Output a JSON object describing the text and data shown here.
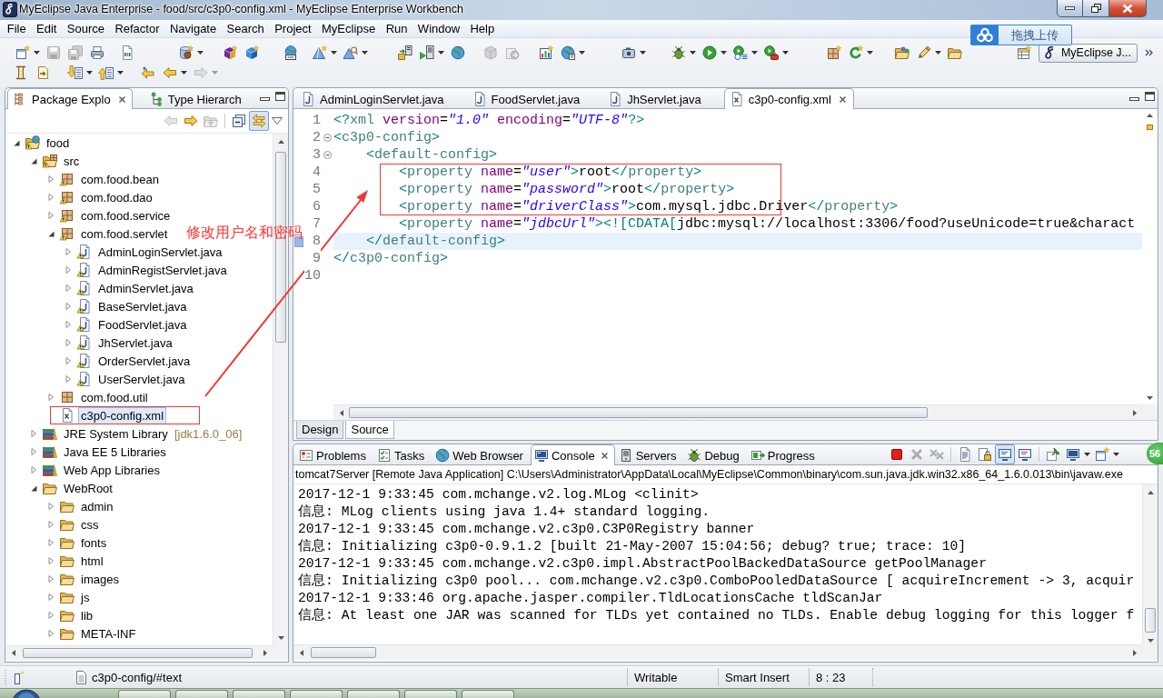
{
  "window": {
    "title": "MyEclipse Java Enterprise - food/src/c3p0-config.xml - MyEclipse Enterprise Workbench"
  },
  "menu_bar": [
    "File",
    "Edit",
    "Source",
    "Refactor",
    "Navigate",
    "Search",
    "Project",
    "MyEclipse",
    "Run",
    "Window",
    "Help"
  ],
  "toolbar": {
    "rows": [
      [
        [
          {
            "kind": "new-wizard",
            "dropdown": true,
            "disabled": false
          },
          {
            "kind": "save",
            "dropdown": false,
            "disabled": true
          },
          {
            "kind": "save-all",
            "dropdown": false,
            "disabled": true
          },
          {
            "kind": "print",
            "dropdown": false,
            "disabled": false
          }
        ],
        [
          {
            "kind": "binary",
            "dropdown": false,
            "disabled": false
          }
        ],
        [
          {
            "kind": "database-bean",
            "dropdown": true,
            "disabled": false
          }
        ],
        [
          {
            "kind": "cube-purple",
            "dropdown": false,
            "disabled": false
          },
          {
            "kind": "cube-blue",
            "dropdown": false,
            "disabled": false
          }
        ],
        [
          {
            "kind": "web-service",
            "dropdown": false,
            "disabled": false
          }
        ],
        [
          {
            "kind": "pyramid-new",
            "dropdown": true,
            "disabled": false
          },
          {
            "kind": "pyramid-search",
            "dropdown": true,
            "disabled": false
          }
        ],
        [
          {
            "kind": "server-deploy",
            "dropdown": false,
            "disabled": false
          },
          {
            "kind": "run-server",
            "dropdown": true,
            "disabled": false
          },
          {
            "kind": "globe",
            "dropdown": false,
            "disabled": false
          }
        ],
        [
          {
            "kind": "box-export",
            "dropdown": false,
            "disabled": true
          },
          {
            "kind": "disc-export",
            "dropdown": false,
            "disabled": true
          }
        ],
        [
          {
            "kind": "chart",
            "dropdown": false,
            "disabled": false
          },
          {
            "kind": "globe-run",
            "dropdown": true,
            "disabled": false
          }
        ],
        [
          {
            "kind": "camera",
            "dropdown": true,
            "disabled": false
          }
        ],
        [
          {
            "kind": "bug",
            "dropdown": true,
            "disabled": false
          },
          {
            "kind": "run",
            "dropdown": true,
            "disabled": false
          },
          {
            "kind": "run-history",
            "dropdown": true,
            "disabled": false
          },
          {
            "kind": "external-tools",
            "dropdown": true,
            "disabled": false
          }
        ],
        [
          {
            "kind": "new-package",
            "dropdown": false,
            "disabled": false
          },
          {
            "kind": "refresh",
            "dropdown": true,
            "disabled": false
          }
        ],
        [
          {
            "kind": "open-project",
            "dropdown": false,
            "disabled": false
          },
          {
            "kind": "pencil",
            "dropdown": true,
            "disabled": false
          },
          {
            "kind": "folder-open",
            "dropdown": false,
            "disabled": false
          }
        ]
      ],
      [
        [
          {
            "kind": "annotation-a",
            "dropdown": false,
            "disabled": false
          },
          {
            "kind": "annotation-b",
            "dropdown": false,
            "disabled": false
          }
        ],
        [
          {
            "kind": "next-annotation",
            "dropdown": true,
            "disabled": false
          },
          {
            "kind": "prev-annotation",
            "dropdown": true,
            "disabled": false
          }
        ],
        [
          {
            "kind": "last-edit",
            "dropdown": false,
            "disabled": false
          },
          {
            "kind": "back",
            "dropdown": true,
            "disabled": false
          },
          {
            "kind": "forward",
            "dropdown": true,
            "disabled": true
          }
        ]
      ]
    ],
    "perspective": {
      "label": "MyEclipse J..."
    }
  },
  "upload_widget": {
    "label": "拖拽上传"
  },
  "package_explorer": {
    "tabs": [
      {
        "label": "Package Explo",
        "kind": "package-explorer",
        "selected": true
      },
      {
        "label": "Type Hierarch",
        "kind": "type-hierarchy",
        "selected": false
      }
    ],
    "toolbar": [
      [
        {
          "kind": "back",
          "disabled": true,
          "pressed": false
        },
        {
          "kind": "forward",
          "disabled": false,
          "pressed": false
        },
        {
          "kind": "up",
          "disabled": true,
          "pressed": false
        }
      ],
      [
        {
          "kind": "collapse-all",
          "disabled": false,
          "pressed": false
        },
        {
          "kind": "link-editor",
          "disabled": false,
          "pressed": true
        },
        {
          "kind": "view-menu",
          "disabled": false,
          "pressed": false
        }
      ]
    ],
    "tree": [
      {
        "label": "food",
        "kind": "project",
        "expanded": true,
        "selected": false,
        "warning": true,
        "children": [
          {
            "label": "src",
            "kind": "source-folder",
            "expanded": true,
            "selected": false,
            "warning": true,
            "children": [
              {
                "label": "com.food.bean",
                "kind": "package",
                "expanded": false,
                "selected": false,
                "warning": true
              },
              {
                "label": "com.food.dao",
                "kind": "package",
                "expanded": false,
                "selected": false,
                "warning": true
              },
              {
                "label": "com.food.service",
                "kind": "package",
                "expanded": false,
                "selected": false,
                "warning": true
              },
              {
                "label": "com.food.servlet",
                "kind": "package",
                "expanded": true,
                "selected": false,
                "warning": true,
                "children": [
                  {
                    "label": "AdminLoginServlet.java",
                    "kind": "java-file",
                    "expanded": false,
                    "selected": false,
                    "warning": true
                  },
                  {
                    "label": "AdminRegistServlet.java",
                    "kind": "java-file",
                    "expanded": false,
                    "selected": false,
                    "warning": true
                  },
                  {
                    "label": "AdminServlet.java",
                    "kind": "java-file",
                    "expanded": false,
                    "selected": false,
                    "warning": true
                  },
                  {
                    "label": "BaseServlet.java",
                    "kind": "java-file",
                    "expanded": false,
                    "selected": false,
                    "warning": true
                  },
                  {
                    "label": "FoodServlet.java",
                    "kind": "java-file",
                    "expanded": false,
                    "selected": false,
                    "warning": true
                  },
                  {
                    "label": "JhServlet.java",
                    "kind": "java-file",
                    "expanded": false,
                    "selected": false,
                    "warning": true
                  },
                  {
                    "label": "OrderServlet.java",
                    "kind": "java-file",
                    "expanded": false,
                    "selected": false,
                    "warning": true
                  },
                  {
                    "label": "UserServlet.java",
                    "kind": "java-file",
                    "expanded": false,
                    "selected": false,
                    "warning": true
                  }
                ]
              },
              {
                "label": "com.food.util",
                "kind": "package",
                "expanded": false,
                "selected": false,
                "warning": false
              },
              {
                "label": "c3p0-config.xml",
                "kind": "xml-file",
                "selected": true,
                "warning": false
              }
            ]
          },
          {
            "label": "JRE System Library",
            "decoration": "[jdk1.6.0_06]",
            "kind": "library",
            "expanded": false,
            "selected": false,
            "warning": false
          },
          {
            "label": "Java EE 5 Libraries",
            "kind": "library",
            "expanded": false,
            "selected": false,
            "warning": false
          },
          {
            "label": "Web App Libraries",
            "kind": "library",
            "expanded": false,
            "selected": false,
            "warning": false
          },
          {
            "label": "WebRoot",
            "kind": "folder",
            "expanded": true,
            "selected": false,
            "warning": false,
            "children": [
              {
                "label": "admin",
                "kind": "folder",
                "expanded": false,
                "selected": false,
                "warning": false
              },
              {
                "label": "css",
                "kind": "folder",
                "expanded": false,
                "selected": false,
                "warning": false
              },
              {
                "label": "fonts",
                "kind": "folder",
                "expanded": false,
                "selected": false,
                "warning": false
              },
              {
                "label": "html",
                "kind": "folder",
                "expanded": false,
                "selected": false,
                "warning": false
              },
              {
                "label": "images",
                "kind": "folder",
                "expanded": false,
                "selected": false,
                "warning": false
              },
              {
                "label": "js",
                "kind": "folder",
                "expanded": false,
                "selected": false,
                "warning": false
              },
              {
                "label": "lib",
                "kind": "folder",
                "expanded": false,
                "selected": false,
                "warning": false
              },
              {
                "label": "META-INF",
                "kind": "folder",
                "expanded": false,
                "selected": false,
                "warning": false
              }
            ]
          }
        ]
      }
    ]
  },
  "editor": {
    "tabs": [
      {
        "label": "AdminLoginServlet.java",
        "kind": "java",
        "selected": false
      },
      {
        "label": "FoodServlet.java",
        "kind": "java",
        "selected": false
      },
      {
        "label": "JhServlet.java",
        "kind": "java",
        "selected": false
      },
      {
        "label": "c3p0-config.xml",
        "kind": "xml",
        "selected": true
      }
    ],
    "lines": [
      {
        "number": "1",
        "current": false,
        "marker": false,
        "tokens": [
          {
            "kind": "delimiter",
            "text": "<?"
          },
          {
            "kind": "tag",
            "text": "xml"
          },
          {
            "kind": "attr",
            "text": " version"
          },
          {
            "kind": "plain",
            "text": "="
          },
          {
            "kind": "value",
            "text": "\"1.0\""
          },
          {
            "kind": "attr",
            "text": " encoding"
          },
          {
            "kind": "plain",
            "text": "="
          },
          {
            "kind": "value",
            "text": "\"UTF-8\""
          },
          {
            "kind": "delimiter",
            "text": "?>"
          }
        ]
      },
      {
        "number": "2",
        "current": false,
        "marker": false,
        "expanded": true,
        "tokens": [
          {
            "kind": "delimiter",
            "text": "<"
          },
          {
            "kind": "tag",
            "text": "c3p0-config"
          },
          {
            "kind": "delimiter",
            "text": ">"
          }
        ]
      },
      {
        "number": "3",
        "current": false,
        "marker": false,
        "expanded": true,
        "tokens": [
          {
            "kind": "delimiter",
            "text": "    <"
          },
          {
            "kind": "tag",
            "text": "default-config"
          },
          {
            "kind": "delimiter",
            "text": ">"
          }
        ]
      },
      {
        "number": "4",
        "current": false,
        "marker": false,
        "tokens": [
          {
            "kind": "delimiter",
            "text": "        <"
          },
          {
            "kind": "tag",
            "text": "property"
          },
          {
            "kind": "attr",
            "text": " name"
          },
          {
            "kind": "plain",
            "text": "="
          },
          {
            "kind": "value",
            "text": "\"user\""
          },
          {
            "kind": "delimiter",
            "text": ">"
          },
          {
            "kind": "plain",
            "text": "root"
          },
          {
            "kind": "delimiter",
            "text": "</"
          },
          {
            "kind": "tag",
            "text": "property"
          },
          {
            "kind": "delimiter",
            "text": ">"
          }
        ]
      },
      {
        "number": "5",
        "current": false,
        "marker": false,
        "tokens": [
          {
            "kind": "delimiter",
            "text": "        <"
          },
          {
            "kind": "tag",
            "text": "property"
          },
          {
            "kind": "attr",
            "text": " name"
          },
          {
            "kind": "plain",
            "text": "="
          },
          {
            "kind": "value",
            "text": "\"password\""
          },
          {
            "kind": "delimiter",
            "text": ">"
          },
          {
            "kind": "plain",
            "text": "root"
          },
          {
            "kind": "delimiter",
            "text": "</"
          },
          {
            "kind": "tag",
            "text": "property"
          },
          {
            "kind": "delimiter",
            "text": ">"
          }
        ]
      },
      {
        "number": "6",
        "current": false,
        "marker": false,
        "tokens": [
          {
            "kind": "delimiter",
            "text": "        <"
          },
          {
            "kind": "tag",
            "text": "property"
          },
          {
            "kind": "attr",
            "text": " name"
          },
          {
            "kind": "plain",
            "text": "="
          },
          {
            "kind": "value",
            "text": "\"driverClass\""
          },
          {
            "kind": "delimiter",
            "text": ">"
          },
          {
            "kind": "plain",
            "text": "com.mysql.jdbc.Driver"
          },
          {
            "kind": "delimiter",
            "text": "</"
          },
          {
            "kind": "tag",
            "text": "property"
          },
          {
            "kind": "delimiter",
            "text": ">"
          }
        ]
      },
      {
        "number": "7",
        "current": false,
        "marker": false,
        "tokens": [
          {
            "kind": "delimiter",
            "text": "        <"
          },
          {
            "kind": "tag",
            "text": "property"
          },
          {
            "kind": "attr",
            "text": " name"
          },
          {
            "kind": "plain",
            "text": "="
          },
          {
            "kind": "value",
            "text": "\"jdbcUrl\""
          },
          {
            "kind": "delimiter",
            "text": "><![CDATA["
          },
          {
            "kind": "plain",
            "text": "jdbc:mysql://localhost:3306/food?useUnicode=true&charact"
          }
        ]
      },
      {
        "number": "8",
        "current": true,
        "marker": true,
        "tokens": [
          {
            "kind": "delimiter",
            "text": "    </"
          },
          {
            "kind": "tag",
            "text": "default-config"
          },
          {
            "kind": "delimiter",
            "text": ">"
          }
        ]
      },
      {
        "number": "9",
        "current": false,
        "marker": false,
        "tokens": [
          {
            "kind": "delimiter",
            "text": "</"
          },
          {
            "kind": "tag",
            "text": "c3p0-config"
          },
          {
            "kind": "delimiter",
            "text": ">"
          }
        ]
      },
      {
        "number": "10",
        "current": false,
        "marker": false
      }
    ],
    "mode_tabs": [
      {
        "label": "Design",
        "selected": false
      },
      {
        "label": "Source",
        "selected": true
      }
    ]
  },
  "console_view": {
    "tabs": [
      {
        "label": "Problems",
        "kind": "problems",
        "selected": false
      },
      {
        "label": "Tasks",
        "kind": "tasks",
        "selected": false
      },
      {
        "label": "Web Browser",
        "kind": "web-browser",
        "selected": false
      },
      {
        "label": "Console",
        "kind": "console",
        "selected": true
      },
      {
        "label": "Servers",
        "kind": "servers",
        "selected": false
      },
      {
        "label": "Debug",
        "kind": "debug",
        "selected": false
      },
      {
        "label": "Progress",
        "kind": "progress",
        "selected": false
      }
    ],
    "toolbar": [
      [
        {
          "kind": "terminate",
          "disabled": false,
          "pressed": false,
          "dropdown": false
        },
        {
          "kind": "remove-launch",
          "disabled": true,
          "pressed": false,
          "dropdown": false
        },
        {
          "kind": "remove-all",
          "disabled": true,
          "pressed": false,
          "dropdown": false
        }
      ],
      [
        {
          "kind": "clear-console",
          "disabled": false,
          "pressed": false,
          "dropdown": false
        },
        {
          "kind": "scroll-lock",
          "disabled": false,
          "pressed": false,
          "dropdown": false
        },
        {
          "kind": "show-on-output",
          "disabled": false,
          "pressed": true,
          "dropdown": false
        },
        {
          "kind": "show-on-error",
          "disabled": false,
          "pressed": false,
          "dropdown": false
        }
      ],
      [
        {
          "kind": "pin-console",
          "disabled": false,
          "pressed": false,
          "dropdown": false
        },
        {
          "kind": "display-console",
          "disabled": false,
          "pressed": false,
          "dropdown": true
        },
        {
          "kind": "open-console",
          "disabled": false,
          "pressed": false,
          "dropdown": true
        }
      ]
    ],
    "description": "tomcat7Server [Remote Java Application] C:\\Users\\Administrator\\AppData\\Local\\MyEclipse\\Common\\binary\\com.sun.java.jdk.win32.x86_64_1.6.0.013\\bin\\javaw.exe",
    "lines": [
      "2017-12-1 9:33:45 com.mchange.v2.log.MLog <clinit>",
      "信息: MLog clients using java 1.4+ standard logging.",
      "2017-12-1 9:33:45 com.mchange.v2.c3p0.C3P0Registry banner",
      "信息: Initializing c3p0-0.9.1.2 [built 21-May-2007 15:04:56; debug? true; trace: 10]",
      "2017-12-1 9:33:45 com.mchange.v2.c3p0.impl.AbstractPoolBackedDataSource getPoolManager",
      "信息: Initializing c3p0 pool... com.mchange.v2.c3p0.ComboPooledDataSource [ acquireIncrement -> 3, acquir",
      "2017-12-1 9:33:46 org.apache.jasper.compiler.TldLocationsCache tldScanJar",
      "信息: At least one JAR was scanned for TLDs yet contained no TLDs. Enable debug logging for this logger f"
    ]
  },
  "status_bar": {
    "node_path": "c3p0-config/#text",
    "write_mode": "Writable",
    "insert_mode": "Smart Insert",
    "cursor_position": "8 : 23"
  },
  "floating_counter": {
    "label": "56"
  },
  "annotation": {
    "note": "修改用户名和密码"
  }
}
